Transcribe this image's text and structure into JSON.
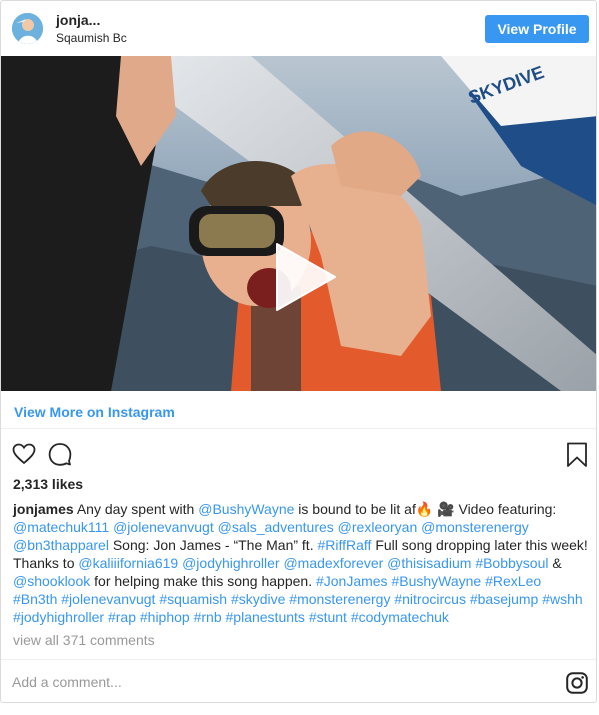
{
  "header": {
    "username": "jonja...",
    "location": "Sqaumish Bc",
    "view_profile_label": "View Profile"
  },
  "media": {
    "type": "video",
    "play_icon": "play-icon"
  },
  "view_more_label": "View More on Instagram",
  "actions": {
    "like_icon": "heart-icon",
    "comment_icon": "speech-bubble-icon",
    "save_icon": "bookmark-icon"
  },
  "likes": "2,313 likes",
  "caption": {
    "username": "jonjames",
    "segments": [
      {
        "t": "text",
        "v": " Any day spent with "
      },
      {
        "t": "link",
        "v": "@BushyWayne"
      },
      {
        "t": "text",
        "v": " is bound to be lit af🔥 🎥 Video featuring: "
      },
      {
        "t": "link",
        "v": "@matechuk111"
      },
      {
        "t": "text",
        "v": " "
      },
      {
        "t": "link",
        "v": "@jolenevanvugt"
      },
      {
        "t": "text",
        "v": " "
      },
      {
        "t": "link",
        "v": "@sals_adventures"
      },
      {
        "t": "text",
        "v": " "
      },
      {
        "t": "link",
        "v": "@rexleoryan"
      },
      {
        "t": "text",
        "v": " "
      },
      {
        "t": "link",
        "v": "@monsterenergy"
      },
      {
        "t": "text",
        "v": " "
      },
      {
        "t": "link",
        "v": "@bn3thapparel"
      },
      {
        "t": "text",
        "v": " Song: Jon James - “The Man” ft. "
      },
      {
        "t": "link",
        "v": "#RiffRaff"
      },
      {
        "t": "text",
        "v": " Full song dropping later this week! Thanks to "
      },
      {
        "t": "link",
        "v": "@kaliiifornia619"
      },
      {
        "t": "text",
        "v": " "
      },
      {
        "t": "link",
        "v": "@jodyhighroller"
      },
      {
        "t": "text",
        "v": " "
      },
      {
        "t": "link",
        "v": "@madexforever"
      },
      {
        "t": "text",
        "v": " "
      },
      {
        "t": "link",
        "v": "@thisisadium"
      },
      {
        "t": "text",
        "v": " "
      },
      {
        "t": "link",
        "v": "#Bobbysoul"
      },
      {
        "t": "text",
        "v": " & "
      },
      {
        "t": "link",
        "v": "@shooklook"
      },
      {
        "t": "text",
        "v": " for helping make this song happen. "
      },
      {
        "t": "link",
        "v": "#JonJames"
      },
      {
        "t": "text",
        "v": " "
      },
      {
        "t": "link",
        "v": "#BushyWayne"
      },
      {
        "t": "text",
        "v": " "
      },
      {
        "t": "link",
        "v": "#RexLeo"
      },
      {
        "t": "text",
        "v": " "
      },
      {
        "t": "link",
        "v": "#Bn3th"
      },
      {
        "t": "text",
        "v": " "
      },
      {
        "t": "link",
        "v": "#jolenevanvugt"
      },
      {
        "t": "text",
        "v": " "
      },
      {
        "t": "link",
        "v": "#squamish"
      },
      {
        "t": "text",
        "v": " "
      },
      {
        "t": "link",
        "v": "#skydive"
      },
      {
        "t": "text",
        "v": " "
      },
      {
        "t": "link",
        "v": "#monsterenergy"
      },
      {
        "t": "text",
        "v": " "
      },
      {
        "t": "link",
        "v": "#nitrocircus"
      },
      {
        "t": "text",
        "v": " "
      },
      {
        "t": "link",
        "v": "#basejump"
      },
      {
        "t": "text",
        "v": " "
      },
      {
        "t": "link",
        "v": "#wshh"
      },
      {
        "t": "text",
        "v": " "
      },
      {
        "t": "link",
        "v": "#jodyhighroller"
      },
      {
        "t": "text",
        "v": " "
      },
      {
        "t": "link",
        "v": "#rap"
      },
      {
        "t": "text",
        "v": " "
      },
      {
        "t": "link",
        "v": "#hiphop"
      },
      {
        "t": "text",
        "v": " "
      },
      {
        "t": "link",
        "v": "#rnb"
      },
      {
        "t": "text",
        "v": " "
      },
      {
        "t": "link",
        "v": "#planestunts"
      },
      {
        "t": "text",
        "v": " "
      },
      {
        "t": "link",
        "v": "#stunt"
      },
      {
        "t": "text",
        "v": " "
      },
      {
        "t": "link",
        "v": "#codymatechuk"
      }
    ]
  },
  "comments_label": "view all 371 comments",
  "add_comment_placeholder": "Add a comment...",
  "instagram_icon": "instagram-glyph-icon",
  "colors": {
    "link": "#3897f0",
    "button": "#3897f0",
    "muted": "#999999",
    "text": "#262626"
  }
}
